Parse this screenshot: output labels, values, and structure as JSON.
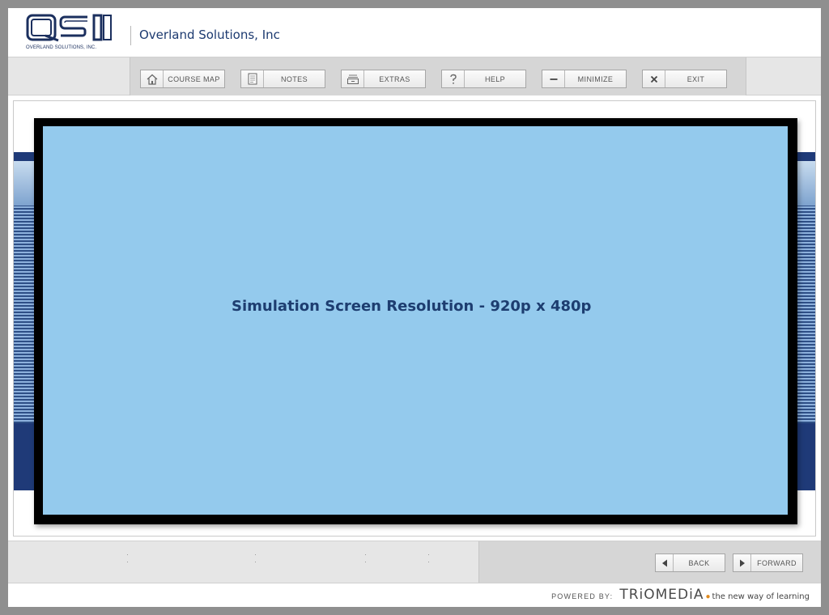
{
  "header": {
    "logo_text": "QSI",
    "logo_subtitle": "OVERLAND SOLUTIONS, INC.",
    "company_name": "Overland Solutions, Inc"
  },
  "toolbar": {
    "buttons": [
      {
        "label": "COURSE MAP",
        "icon": "home-icon"
      },
      {
        "label": "NOTES",
        "icon": "document-icon"
      },
      {
        "label": "EXTRAS",
        "icon": "tray-icon"
      },
      {
        "label": "HELP",
        "icon": "help-icon"
      },
      {
        "label": "MINIMIZE",
        "icon": "minus-icon"
      },
      {
        "label": "EXIT",
        "icon": "close-icon"
      }
    ]
  },
  "simulation": {
    "text": "Simulation Screen Resolution - 920p x 480p"
  },
  "navigation": {
    "back_label": "BACK",
    "forward_label": "FORWARD"
  },
  "footer": {
    "powered_by": "POWERED BY:",
    "brand": "TRiOMEDiA",
    "tagline": "the new way of learning"
  },
  "colors": {
    "brand_navy": "#1c3a70",
    "screen_blue": "#94caed",
    "band_blue": "#1f3a78",
    "accent_orange": "#e08a1e"
  }
}
